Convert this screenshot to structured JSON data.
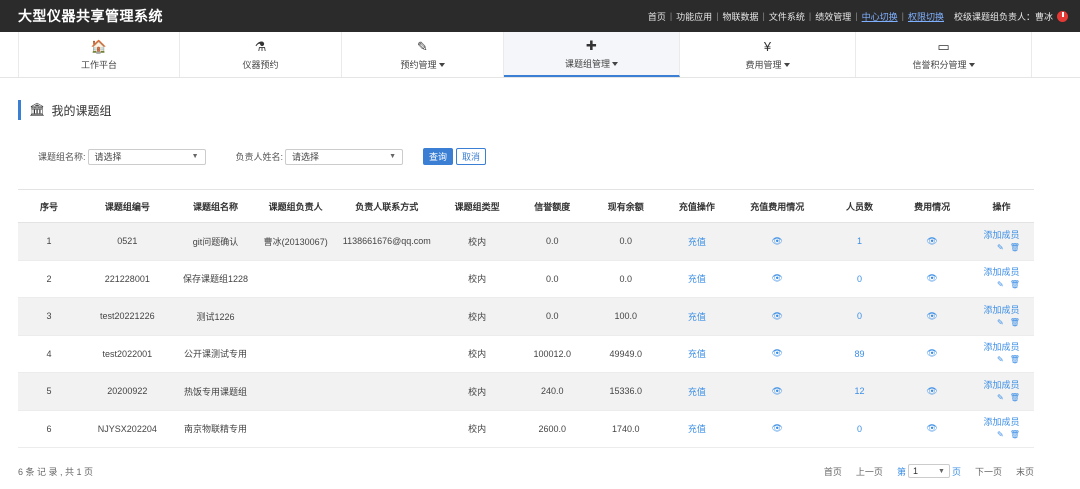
{
  "app": {
    "title": "大型仪器共享管理系统"
  },
  "top_links": [
    {
      "label": "首页",
      "highlight": false
    },
    {
      "label": "功能应用",
      "highlight": false
    },
    {
      "label": "物联数据",
      "highlight": false
    },
    {
      "label": "文件系统",
      "highlight": false
    },
    {
      "label": "绩效管理",
      "highlight": false
    },
    {
      "label": "中心切换",
      "highlight": true
    },
    {
      "label": "权限切换",
      "highlight": true
    }
  ],
  "user_label": "校级课题组负责人：曹冰",
  "nav": [
    {
      "label": "工作平台",
      "icon": "home-icon",
      "glyph": "🏠",
      "dropdown": false
    },
    {
      "label": "仪器预约",
      "icon": "flask-icon",
      "glyph": "⚗",
      "dropdown": false
    },
    {
      "label": "预约管理",
      "icon": "edit-icon",
      "glyph": "✎",
      "dropdown": true
    },
    {
      "label": "课题组管理",
      "icon": "puzzle-icon",
      "glyph": "✚",
      "dropdown": true
    },
    {
      "label": "费用管理",
      "icon": "yen-icon",
      "glyph": "¥",
      "dropdown": true
    },
    {
      "label": "信誉积分管理",
      "icon": "card-icon",
      "glyph": "▭",
      "dropdown": true
    }
  ],
  "section": {
    "title": "我的课题组"
  },
  "filters": {
    "group_name_label": "课题组名称:",
    "group_name_value": "请选择",
    "leader_label": "负责人姓名:",
    "leader_value": "请选择",
    "query_button": "查询",
    "cancel_button": "取消"
  },
  "table": {
    "headers": [
      "序号",
      "课题组编号",
      "课题组名称",
      "课题组负责人",
      "负责人联系方式",
      "课题组类型",
      "信誉额度",
      "现有余额",
      "充值操作",
      "充值费用情况",
      "人员数",
      "费用情况",
      "操作"
    ],
    "rows": [
      {
        "no": "1",
        "code": "0521",
        "name": "git问题确认",
        "leader": "曹冰(20130067)",
        "contact": "1138661676@qq.com",
        "type": "校内",
        "credit": "0.0",
        "balance": "0.0",
        "recharge": "充值",
        "members": "1",
        "add": "添加成员"
      },
      {
        "no": "2",
        "code": "221228001",
        "name": "保存课题组1228",
        "leader": "",
        "contact": "",
        "type": "校内",
        "credit": "0.0",
        "balance": "0.0",
        "recharge": "充值",
        "members": "0",
        "add": "添加成员"
      },
      {
        "no": "3",
        "code": "test20221226",
        "name": "测试1226",
        "leader": "",
        "contact": "",
        "type": "校内",
        "credit": "0.0",
        "balance": "100.0",
        "recharge": "充值",
        "members": "0",
        "add": "添加成员"
      },
      {
        "no": "4",
        "code": "test2022001",
        "name": "公开课测试专用",
        "leader": "",
        "contact": "",
        "type": "校内",
        "credit": "100012.0",
        "balance": "49949.0",
        "recharge": "充值",
        "members": "89",
        "add": "添加成员"
      },
      {
        "no": "5",
        "code": "20200922",
        "name": "热饭专用课题组",
        "leader": "",
        "contact": "",
        "type": "校内",
        "credit": "240.0",
        "balance": "15336.0",
        "recharge": "充值",
        "members": "12",
        "add": "添加成员"
      },
      {
        "no": "6",
        "code": "NJYSX202204",
        "name": "南京物联精专用",
        "leader": "",
        "contact": "",
        "type": "校内",
        "credit": "2600.0",
        "balance": "1740.0",
        "recharge": "充值",
        "members": "0",
        "add": "添加成员"
      }
    ]
  },
  "footer": {
    "summary": "6 条 记 录 , 共 1 页",
    "first": "首页",
    "prev": "上一页",
    "page_prefix": "第",
    "page_value": "1",
    "page_suffix": "页",
    "next": "下一页",
    "last": "末页"
  },
  "colors": {
    "accent": "#3b7fd4",
    "link": "#3b8ee6",
    "topbar": "#2b2b2b"
  }
}
